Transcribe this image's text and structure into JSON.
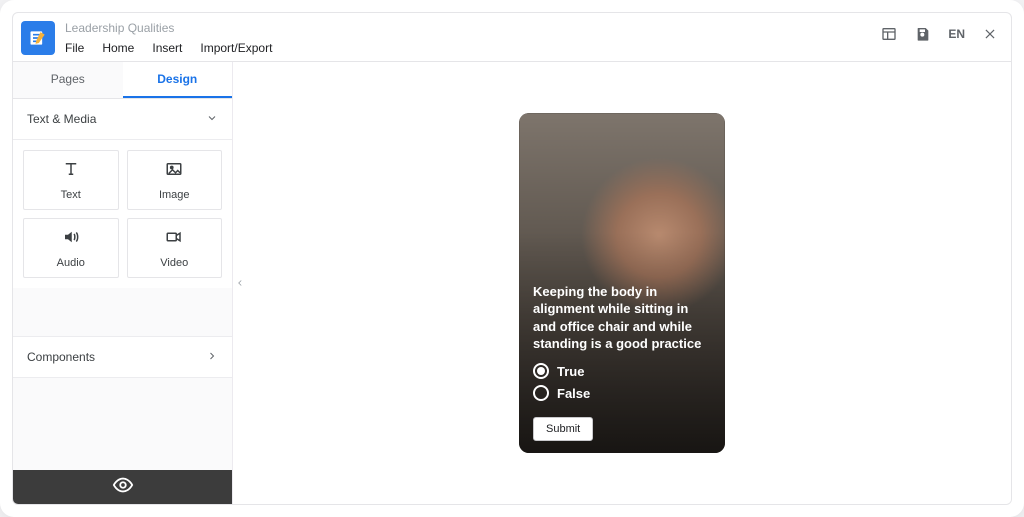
{
  "header": {
    "title": "Leadership Qualities",
    "menu": {
      "file": "File",
      "home": "Home",
      "insert": "Insert",
      "import_export": "Import/Export"
    },
    "lang": "EN"
  },
  "sidebar": {
    "tabs": {
      "pages": "Pages",
      "design": "Design"
    },
    "section_text_media": "Text & Media",
    "cards": {
      "text": "Text",
      "image": "Image",
      "audio": "Audio",
      "video": "Video"
    },
    "components": "Components"
  },
  "canvas": {
    "question": "Keeping the body in alignment while sitting in and office chair and while standing is a good practice",
    "option_true": "True",
    "option_false": "False",
    "submit": "Submit"
  }
}
